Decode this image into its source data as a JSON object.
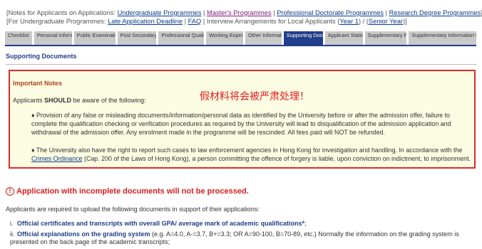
{
  "notes": {
    "line1_prefix": "[Notes for Applicants on Applications: ",
    "line1_links": [
      "Undergraduate Programmes",
      "Master's Programmes",
      "Professional Doctorate Programmes",
      "Research Degree Programmes"
    ],
    "line1_suffix": "]",
    "line2_prefix": "[For Undergraduate Programmes: ",
    "late_link": "Late Application Deadline",
    "faq_link": "FAQ",
    "interview_text": " | Interview Arrangements for Local Applicants (",
    "year1_link": "Year 1",
    "slash": ") / (",
    "senior_link": "Senior Year",
    "line2_suffix": ")]"
  },
  "tabs": [
    {
      "label": "Checklist",
      "active": false
    },
    {
      "label": "Personal Information",
      "active": false
    },
    {
      "label": "Public Examinations",
      "active": false
    },
    {
      "label": "Post Secondary Education",
      "active": false
    },
    {
      "label": "Professional Qualifications",
      "active": false
    },
    {
      "label": "Working Experience",
      "active": false
    },
    {
      "label": "Other Information",
      "active": false
    },
    {
      "label": "Supporting Documents",
      "active": true
    },
    {
      "label": "Applicant Statement",
      "active": false
    },
    {
      "label": "Supplementary Form",
      "active": false
    },
    {
      "label": "Supplementary Information for Non-Local Applicants",
      "active": false
    }
  ],
  "section_title": "Supporting Documents",
  "notice": {
    "heading": "Important Notes",
    "overlay_cn": "假材料将会被严肃处理！",
    "lead_pre": "Applicants ",
    "lead_bold": "SHOULD",
    "lead_post": " be aware of the following:",
    "bullet1": "♦ Provision of any false or misleading documents/information/personal data as identified by the University before or after the admission offer, failure to complete the qualification checking or verification procedures as required by the University will lead to disqualification of the admission application and withdrawal of the admission offer. Any enrolment made in the programme will be rescinded. All fees paid will NOT be refunded.",
    "bullet2_pre": "♦ The University also have the right to report such cases to law enforcement agencies in Hong Kong for investigation and handling. In accordance with the ",
    "bullet2_link": "Crimes Ordinance",
    "bullet2_post": " (Cap. 200 of the Laws of Hong Kong), a person committing the offence of forgery is liable, upon conviction on indictment, to imprisonment."
  },
  "warning": {
    "icon": "!",
    "text": "Application with incomplete documents will not be processed."
  },
  "intro": "Applicants are required to upload the following documents in support of their applications:",
  "requirements": [
    {
      "num": "i.",
      "bold": "Official certificates and transcripts with overall GPA/ average mark of academic qualifications*",
      "rest": ";"
    },
    {
      "num": "ii.",
      "bold": "Official explanations on the grading system",
      "rest": " (e.g. A=4.0, A-=3.7, B+=3.3; OR A=90-100, B=70-89, etc.) Normally the information on the grading system is presented on the back page of the academic transcripts;"
    }
  ],
  "colors": {
    "accent": "#213e8a",
    "warning": "#d81e1e",
    "notice_bg": "#fcfce2"
  }
}
